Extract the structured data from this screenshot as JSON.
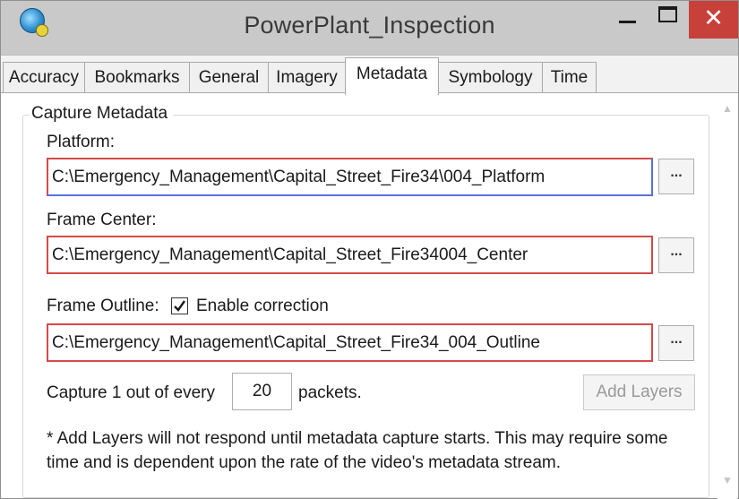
{
  "window": {
    "title": "PowerPlant_Inspection",
    "icon": "globe-icon",
    "close_glyph": "✕",
    "accent_close": "#c7413a"
  },
  "tabs": [
    {
      "label": "Accuracy"
    },
    {
      "label": "Bookmarks"
    },
    {
      "label": "General"
    },
    {
      "label": "Imagery"
    },
    {
      "label": "Metadata",
      "active": true
    },
    {
      "label": "Symbology"
    },
    {
      "label": "Time"
    }
  ],
  "capture": {
    "group_title": "Capture Metadata",
    "platform_label": "Platform:",
    "platform_value": "C:\\Emergency_Management\\Capital_Street_Fire34\\004_Platform",
    "frame_center_label": "Frame Center:",
    "frame_center_value": "C:\\Emergency_Management\\Capital_Street_Fire34004_Center",
    "frame_outline_label": "Frame Outline:",
    "enable_correction_label": "Enable correction",
    "enable_correction_checked": true,
    "frame_outline_value": "C:\\Emergency_Management\\Capital_Street_Fire34_004_Outline",
    "browse_label": "...",
    "capture_prefix": "Capture 1 out of every",
    "packets_value": "20",
    "capture_suffix": "packets.",
    "add_layers_label": "Add Layers",
    "note": "* Add Layers will not respond until metadata capture starts. This may require some time and is dependent upon the rate of the video's metadata stream."
  }
}
